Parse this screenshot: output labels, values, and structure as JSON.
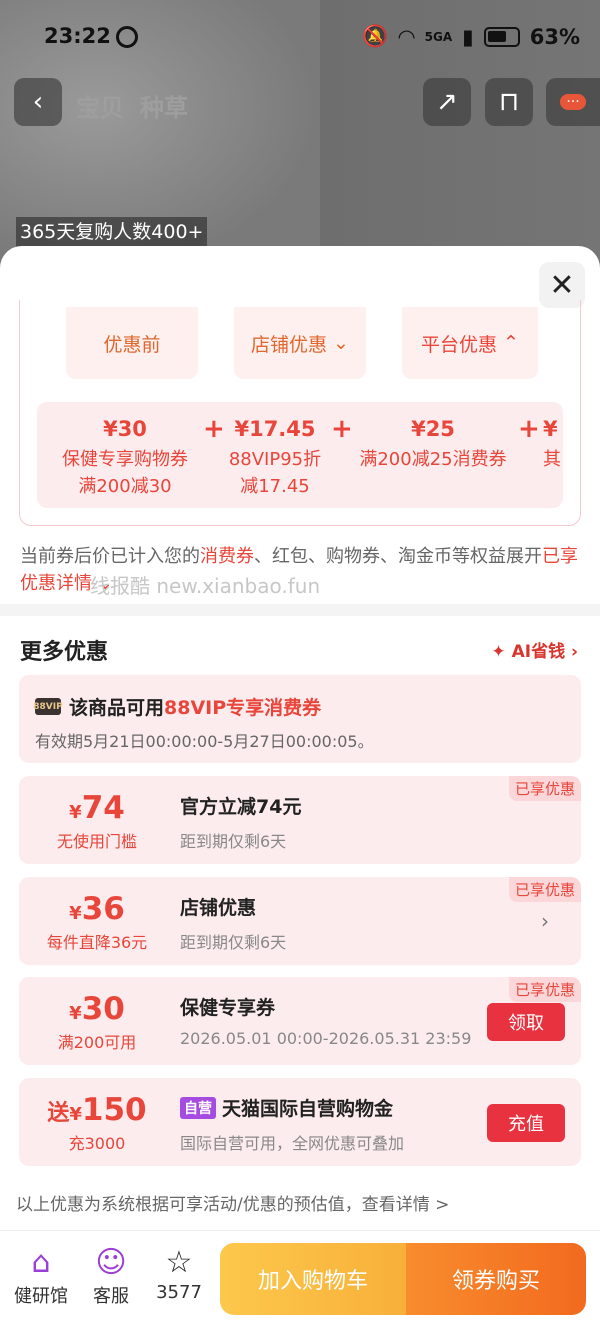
{
  "status": {
    "time": "23:22",
    "network": "5GA",
    "battery": "63%"
  },
  "nav": {
    "tab1": "宝贝",
    "tab2": "种草",
    "more_badge": "···"
  },
  "repurchase": "365天复购人数400+",
  "calc": {
    "segments": [
      "优惠前",
      "店铺优惠",
      "平台优惠"
    ],
    "discounts": [
      {
        "amount": "¥30",
        "line1": "保健专享购物券",
        "line2": "满200减30"
      },
      {
        "amount": "¥17.45",
        "line1": "88VIP95折",
        "line2": "减17.45"
      },
      {
        "amount": "¥25",
        "line1": "满200减25消费券",
        "line2": ""
      },
      {
        "amount": "¥",
        "line1": "其",
        "line2": ""
      }
    ],
    "plus": "+"
  },
  "note": {
    "p1": "当前券后价已计入您的",
    "hl1": "消费券",
    "p2": "、红包、购物券、淘金币等权益展开",
    "hl2": "已享优惠详情"
  },
  "watermark": "线报酷 new.xianbao.fun",
  "more": {
    "title": "更多优惠",
    "ai": "AI省钱 ›"
  },
  "vip": {
    "icon": "88VIP",
    "title_pre": "该商品可用",
    "title_hl": "88VIP专享消费券",
    "validity": "有效期5月21日00:00:00-5月27日00:00:05。"
  },
  "cards": [
    {
      "big": "74",
      "sub": "无使用门槛",
      "title": "官方立减74元",
      "desc": "距到期仅剩6天",
      "badge": "已享优惠",
      "action": ""
    },
    {
      "big": "36",
      "sub": "每件直降36元",
      "title": "店铺优惠",
      "desc": "距到期仅剩6天",
      "badge": "已享优惠",
      "action": "›"
    },
    {
      "big": "30",
      "sub": "满200可用",
      "title": "保健专享券",
      "desc": "2026.05.01 00:00-2026.05.31 23:59",
      "badge": "已享优惠",
      "action": "领取"
    },
    {
      "pre": "送",
      "big": "150",
      "sub": "充3000",
      "tag": "自营",
      "title": "天猫国际自营购物金",
      "desc": "国际自营可用，全网优惠可叠加",
      "badge": "",
      "action": "充值"
    }
  ],
  "yen": "¥",
  "footnote": "以上优惠为系统根据可享活动/优惠的预估值，查看详情 >",
  "bottom": {
    "shop": "健研馆",
    "service": "客服",
    "fav_count": "3577",
    "cart": "加入购物车",
    "buy": "领券购买"
  }
}
